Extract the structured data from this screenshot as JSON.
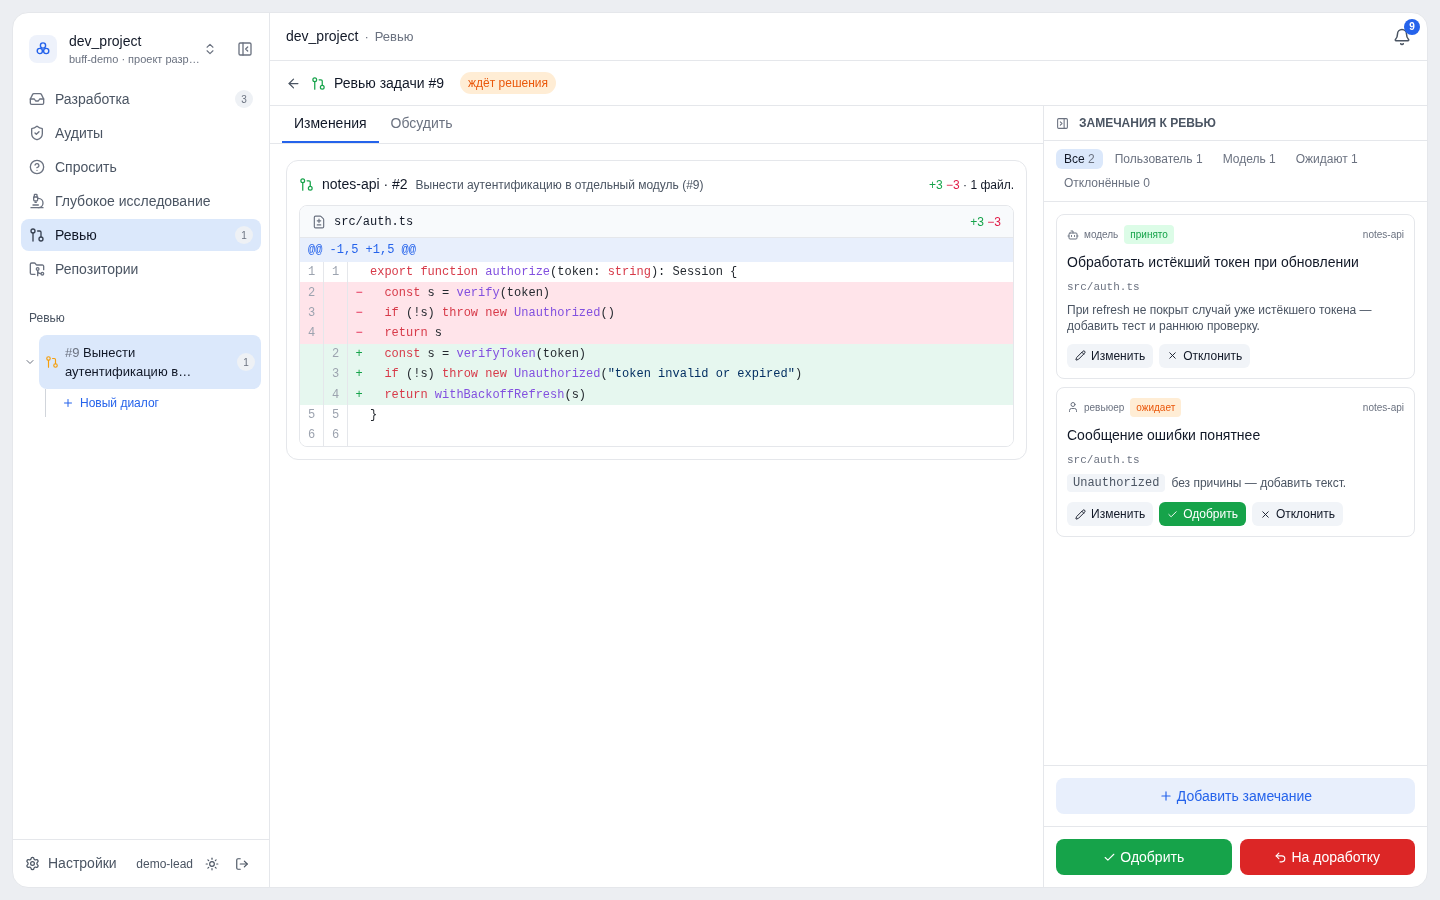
{
  "project": {
    "name": "dev_project",
    "subtitle": "buff-demo · проект разр…"
  },
  "nav": [
    {
      "label": "Разработка",
      "badge": "3",
      "selected": false
    },
    {
      "label": "Аудиты",
      "selected": false
    },
    {
      "label": "Спросить",
      "selected": false
    },
    {
      "label": "Глубокое исследование",
      "selected": false
    },
    {
      "label": "Ревью",
      "badge": "1",
      "selected": true
    },
    {
      "label": "Репозитории",
      "selected": false
    }
  ],
  "section": {
    "title": "Ревью",
    "items": [
      {
        "number": "#9",
        "title": "Вынести аутентификацию в…",
        "badge": "1",
        "selected": true,
        "expanded": true,
        "children": [
          {
            "label": "Новый диалог"
          }
        ]
      }
    ]
  },
  "footer": {
    "settings": "Настройки",
    "user": "demo-lead"
  },
  "breadcrumb": [
    "dev_project",
    "·",
    "Ревью"
  ],
  "notifications": "9",
  "review": {
    "title": "Ревью задачи #9",
    "status": {
      "kind": "pending",
      "label": "ждёт решения"
    }
  },
  "tabs": [
    {
      "label": "Изменения",
      "selected": true
    },
    {
      "label": "Обсудить",
      "selected": false
    }
  ],
  "change": {
    "repo": "notes-api · #2",
    "title": "Вынести аутентификацию в отдельный модуль (#9)",
    "added": "+3",
    "removed": "−3",
    "files": "· 1 файл.",
    "file": {
      "path": "src/auth.ts",
      "added": "+3",
      "removed": "−3",
      "hunk": "@@ -1,5 +1,5 @@",
      "lines": [
        {
          "kind": "context",
          "old": "1",
          "new": "1",
          "tokens": [
            {
              "kind": "kw",
              "text": "export function"
            },
            {
              "kind": "fn",
              "text": " authorize"
            },
            {
              "kind": "plain",
              "text": "(token: "
            },
            {
              "kind": "kw",
              "text": "string"
            },
            {
              "kind": "plain",
              "text": "): Session {"
            }
          ]
        },
        {
          "kind": "del",
          "old": "2",
          "marker": "−",
          "tokens": [
            {
              "kind": "kw",
              "text": "  const"
            },
            {
              "kind": "plain",
              "text": " s = "
            },
            {
              "kind": "fn",
              "text": "verify"
            },
            {
              "kind": "plain",
              "text": "(token)"
            }
          ]
        },
        {
          "kind": "del",
          "old": "3",
          "marker": "−",
          "tokens": [
            {
              "kind": "kw",
              "text": "  if"
            },
            {
              "kind": "plain",
              "text": " (!s) "
            },
            {
              "kind": "kw",
              "text": "throw new"
            },
            {
              "kind": "fn",
              "text": " Unauthorized"
            },
            {
              "kind": "plain",
              "text": "()"
            }
          ]
        },
        {
          "kind": "del",
          "old": "4",
          "marker": "−",
          "tokens": [
            {
              "kind": "kw",
              "text": "  return"
            },
            {
              "kind": "plain",
              "text": " s"
            }
          ]
        },
        {
          "kind": "add",
          "new": "2",
          "marker": "+",
          "tokens": [
            {
              "kind": "kw",
              "text": "  const"
            },
            {
              "kind": "plain",
              "text": " s = "
            },
            {
              "kind": "fn",
              "text": "verifyToken"
            },
            {
              "kind": "plain",
              "text": "(token)"
            }
          ]
        },
        {
          "kind": "add",
          "new": "3",
          "marker": "+",
          "tokens": [
            {
              "kind": "kw",
              "text": "  if"
            },
            {
              "kind": "plain",
              "text": " (!s) "
            },
            {
              "kind": "kw",
              "text": "throw new"
            },
            {
              "kind": "fn",
              "text": " Unauthorized"
            },
            {
              "kind": "plain",
              "text": "("
            },
            {
              "kind": "str",
              "text": "\"token invalid or expired\""
            },
            {
              "kind": "plain",
              "text": ")"
            }
          ]
        },
        {
          "kind": "add",
          "new": "4",
          "marker": "+",
          "tokens": [
            {
              "kind": "kw",
              "text": "  return"
            },
            {
              "kind": "fn",
              "text": " withBackoffRefresh"
            },
            {
              "kind": "plain",
              "text": "(s)"
            }
          ]
        },
        {
          "kind": "context",
          "old": "5",
          "new": "5",
          "tokens": [
            {
              "kind": "plain",
              "text": "}"
            }
          ]
        },
        {
          "kind": "context",
          "old": "6",
          "new": "6"
        }
      ]
    }
  },
  "comments_panel": {
    "title": "ЗАМЕЧАНИЯ К РЕВЬЮ",
    "filters": [
      {
        "label": "Все",
        "count": "2",
        "selected": true
      },
      {
        "label": "Пользователь",
        "count": "1",
        "selected": false
      },
      {
        "label": "Модель",
        "count": "1",
        "selected": false
      },
      {
        "label": "Ожидают",
        "count": "1",
        "selected": false
      },
      {
        "label": "Отклонённые",
        "count": "0",
        "selected": false
      }
    ],
    "comments": [
      {
        "author": {
          "kind": "model",
          "label": "модель"
        },
        "status": {
          "kind": "accepted",
          "label": "принято"
        },
        "repo": "notes-api",
        "title": "Обработать истёкший токен при обновлении",
        "file": "src/auth.ts",
        "body": [
          {
            "kind": "text",
            "text": "При refresh не покрыт случай уже истёкшего токена — добавить тест и раннюю проверку."
          }
        ],
        "actions": [
          {
            "kind": "edit",
            "label": "Изменить"
          },
          {
            "kind": "reject",
            "label": "Отклонить"
          }
        ]
      },
      {
        "author": {
          "kind": "user",
          "label": "ревьюер"
        },
        "status": {
          "kind": "pending",
          "label": "ожидает"
        },
        "repo": "notes-api",
        "title": "Сообщение ошибки понятнее",
        "file": "src/auth.ts",
        "body": [
          {
            "kind": "code",
            "text": "Unauthorized"
          },
          {
            "kind": "text",
            "text": "без причины — добавить текст."
          }
        ],
        "actions": [
          {
            "kind": "edit",
            "label": "Изменить"
          },
          {
            "kind": "approve",
            "label": "Одобрить"
          },
          {
            "kind": "reject",
            "label": "Отклонить"
          }
        ]
      }
    ],
    "add": "Добавить замечание",
    "approve": "Одобрить",
    "rework": "На доработку"
  }
}
